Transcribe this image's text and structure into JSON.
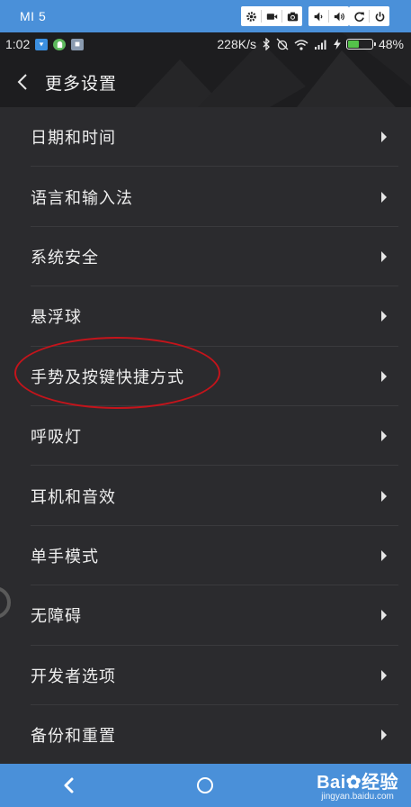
{
  "emulator": {
    "title": "MI 5",
    "bar_color": "#4a90d9"
  },
  "status_bar": {
    "time": "1:02",
    "net_speed": "228K/s",
    "battery_percent": "48%",
    "battery_level": 0.48
  },
  "header": {
    "title": "更多设置"
  },
  "settings": {
    "items": [
      {
        "label": "日期和时间"
      },
      {
        "label": "语言和输入法"
      },
      {
        "label": "系统安全"
      },
      {
        "label": "悬浮球"
      },
      {
        "label": "手势及按键快捷方式"
      },
      {
        "label": "呼吸灯"
      },
      {
        "label": "耳机和音效"
      },
      {
        "label": "单手模式"
      },
      {
        "label": "无障碍"
      },
      {
        "label": "开发者选项"
      },
      {
        "label": "备份和重置"
      }
    ]
  },
  "watermark": {
    "main": "Bai",
    "main_suffix": "经验",
    "sub": "jingyan.baidu.com"
  },
  "colors": {
    "highlight": "#c4141b",
    "accent": "#4a90d9"
  }
}
